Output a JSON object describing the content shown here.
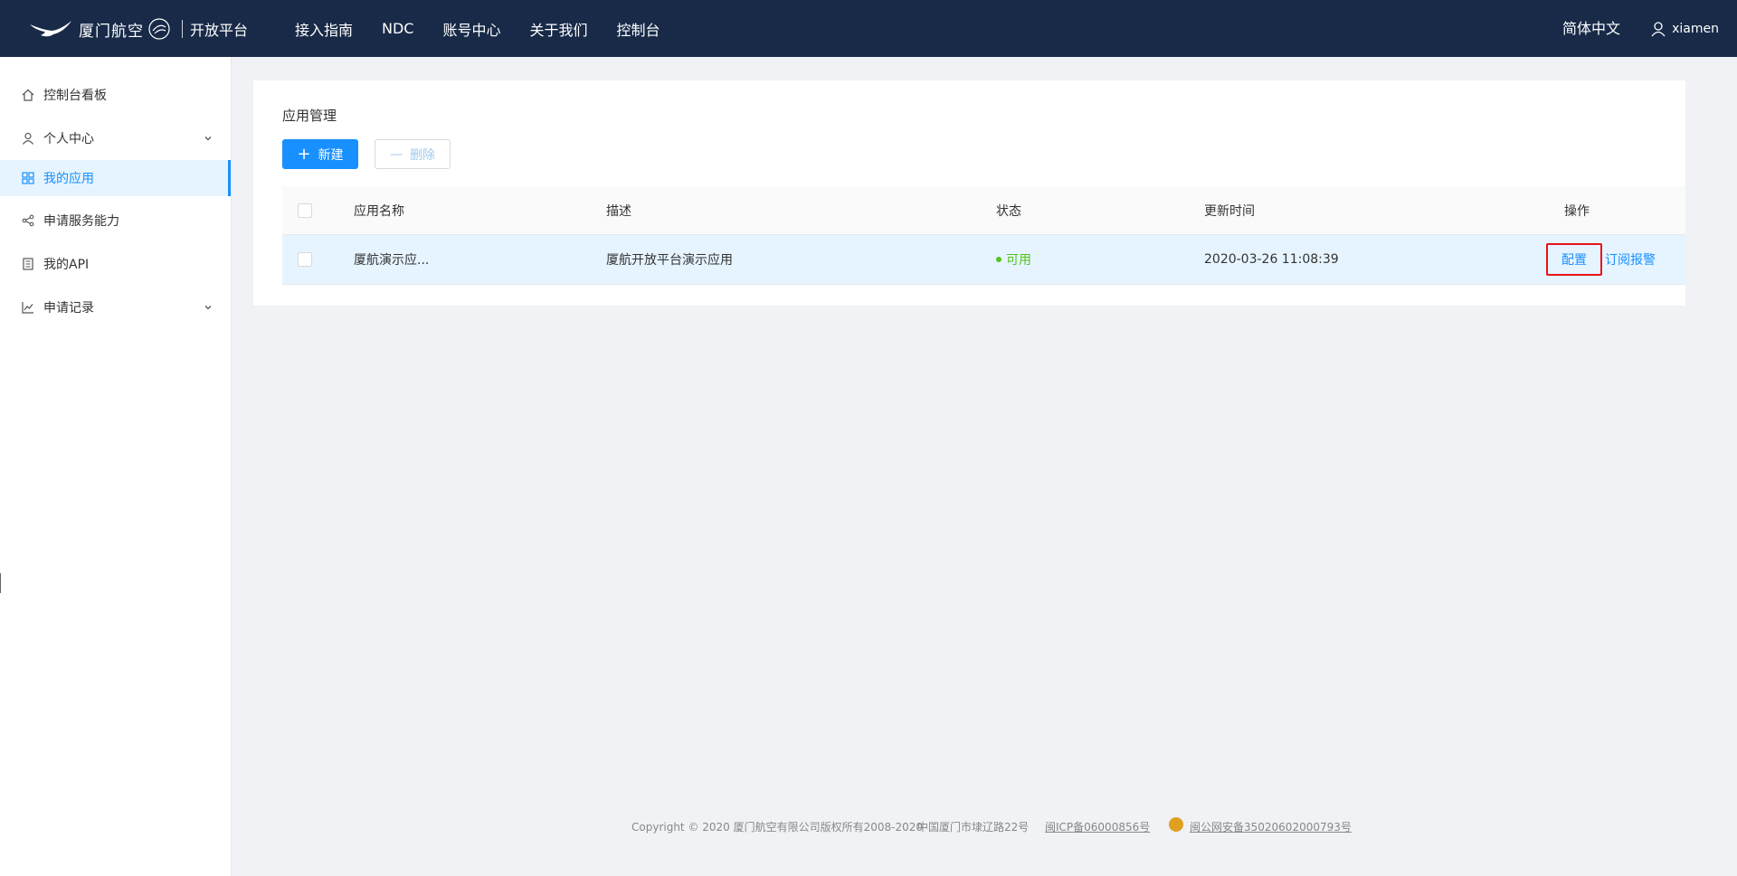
{
  "header": {
    "brand": "厦门航空",
    "platform": "开放平台",
    "nav": [
      "接入指南",
      "NDC",
      "账号中心",
      "关于我们",
      "控制台"
    ],
    "language": "简体中文",
    "username": "xiamen"
  },
  "sidebar": {
    "items": [
      {
        "label": "控制台看板",
        "icon": "home-icon"
      },
      {
        "label": "个人中心",
        "icon": "user-icon"
      },
      {
        "label": "我的应用",
        "icon": "apps-icon"
      },
      {
        "label": "申请服务能力",
        "icon": "share-icon"
      },
      {
        "label": "我的API",
        "icon": "document-icon"
      },
      {
        "label": "申请记录",
        "icon": "chart-icon"
      }
    ]
  },
  "main": {
    "title": "应用管理",
    "new_button": "新建",
    "delete_button": "删除",
    "table": {
      "columns": [
        "应用名称",
        "描述",
        "状态",
        "更新时间",
        "操作"
      ],
      "rows": [
        {
          "name": "厦航演示应...",
          "description": "厦航开放平台演示应用",
          "status": "可用",
          "updated": "2020-03-26 11:08:39",
          "actions": [
            "配置",
            "订阅报警"
          ]
        }
      ]
    }
  },
  "footer": {
    "copyright": "Copyright © 2020 厦门航空有限公司版权所有2008-2020",
    "address": "中国厦门市埭辽路22号",
    "icp": "闽ICP备06000856号",
    "police": "闽公网安备35020602000793号"
  },
  "colors": {
    "header_bg": "#182a48",
    "primary": "#1890ff",
    "success": "#52c41a",
    "highlight_box": "#e5141b"
  }
}
